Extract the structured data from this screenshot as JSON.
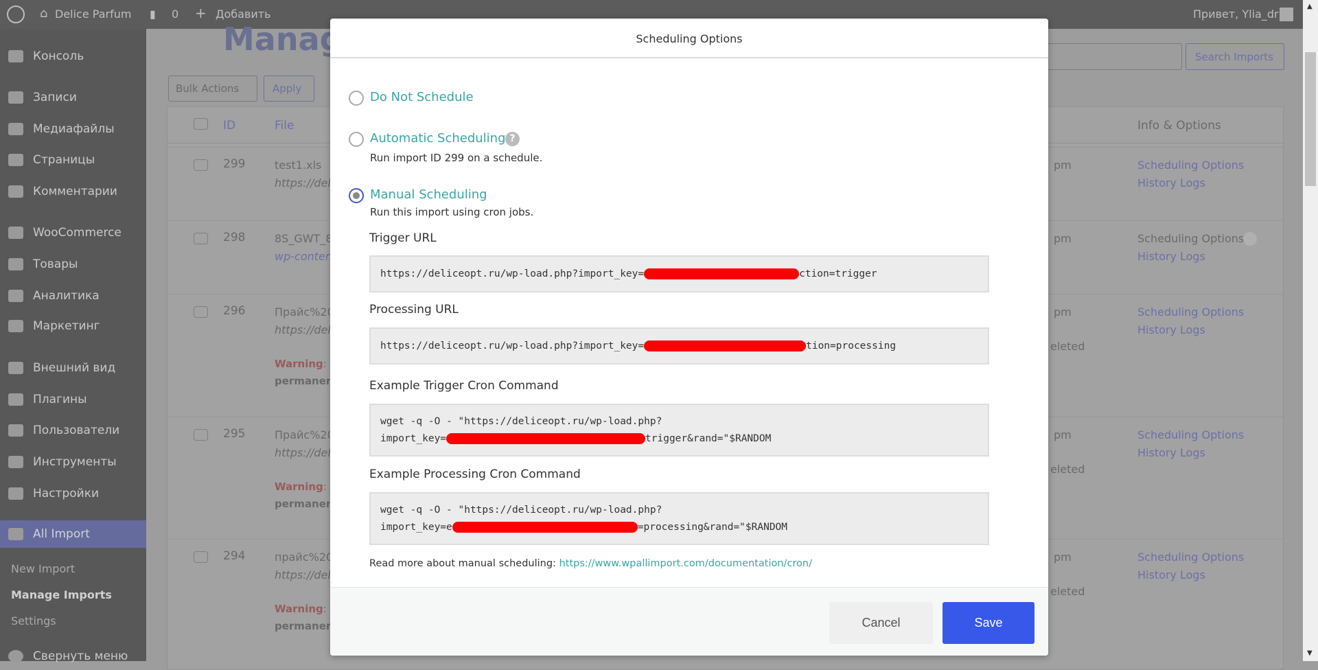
{
  "topbar": {
    "site": "Delice Parfum",
    "comments": "0",
    "add": "Добавить",
    "greeting": "Привет, Ylia_dr"
  },
  "sidebar": {
    "items": [
      {
        "label": "Консоль",
        "icon": "dashboard-icon"
      },
      {
        "label": "Записи",
        "icon": "pin-icon"
      },
      {
        "label": "Медиафайлы",
        "icon": "media-icon"
      },
      {
        "label": "Страницы",
        "icon": "pages-icon"
      },
      {
        "label": "Комментарии",
        "icon": "comments-icon"
      },
      {
        "label": "WooCommerce",
        "icon": "woo-icon"
      },
      {
        "label": "Товары",
        "icon": "products-icon"
      },
      {
        "label": "Аналитика",
        "icon": "analytics-icon"
      },
      {
        "label": "Маркетинг",
        "icon": "megaphone-icon"
      },
      {
        "label": "Внешний вид",
        "icon": "brush-icon"
      },
      {
        "label": "Плагины",
        "icon": "plugin-icon"
      },
      {
        "label": "Пользователи",
        "icon": "user-icon"
      },
      {
        "label": "Инструменты",
        "icon": "wrench-icon"
      },
      {
        "label": "Настройки",
        "icon": "settings-icon"
      },
      {
        "label": "All Import",
        "icon": "all-import-icon"
      }
    ],
    "sub": [
      "New Import",
      "Manage Imports",
      "Settings"
    ],
    "collapse": "Свернуть меню"
  },
  "page": {
    "title": "Manage Imports",
    "bulk": "Bulk Actions",
    "apply": "Apply",
    "search_btn": "Search Imports",
    "columns": {
      "id": "ID",
      "file": "File",
      "info": "Info & Options"
    },
    "rows": [
      {
        "id": "299",
        "file": "test1.xls",
        "path": "https://deli",
        "time": "pm",
        "warn": "",
        "perm": "",
        "del": ""
      },
      {
        "id": "298",
        "file": "8S_GWT_8",
        "path": "wp-content",
        "time": "pm",
        "warn": "",
        "perm": "",
        "del": ""
      },
      {
        "id": "296",
        "file": "Прайс%20",
        "path": "https://deli",
        "time": "pm",
        "warn": "Warning",
        "perm": "permanentl",
        "del": "eleted"
      },
      {
        "id": "295",
        "file": "Прайс%20",
        "path": "https://deli",
        "time": "pm",
        "warn": "Warning",
        "perm": "permanentl",
        "del": "eleted"
      },
      {
        "id": "294",
        "file": "прайс%20",
        "path": "https://deli",
        "time": "pm",
        "warn": "Warning",
        "perm": "permanentl",
        "del": "eleted"
      }
    ],
    "sched": "Scheduling Options",
    "history": "History Logs",
    "warn_rest": ": T"
  },
  "modal": {
    "title": "Scheduling Options",
    "options": [
      {
        "label": "Do Not Schedule",
        "selected": false
      },
      {
        "label": "Automatic Scheduling",
        "desc": "Run import ID 299 on a schedule.",
        "selected": false
      },
      {
        "label": "Manual Scheduling",
        "desc": "Run this import using cron jobs.",
        "selected": true
      }
    ],
    "trigger_label": "Trigger URL",
    "trigger_pre": "https://deliceopt.ru/wp-load.php?import_key=",
    "trigger_post": "ction=trigger",
    "processing_label": "Processing URL",
    "processing_pre": "https://deliceopt.ru/wp-load.php?import_key=",
    "processing_post": "tion=processing",
    "cron_trigger_label": "Example Trigger Cron Command",
    "cron_line1": "wget -q -O - \"https://deliceopt.ru/wp-load.php?",
    "cron_t_pre": "import_key=",
    "cron_t_post": "trigger&rand=\"$RANDOM",
    "cron_processing_label": "Example Processing Cron Command",
    "cron_p_pre": "import_key=e",
    "cron_p_post": "=processing&rand=\"$RANDOM",
    "read_more": "Read more about manual scheduling:",
    "read_more_link": "https://www.wpallimport.com/documentation/cron/",
    "cancel": "Cancel",
    "save": "Save"
  },
  "colors": {
    "accent": "#3aa5a5",
    "save": "#3858e9",
    "redaction": "#ff0000"
  }
}
